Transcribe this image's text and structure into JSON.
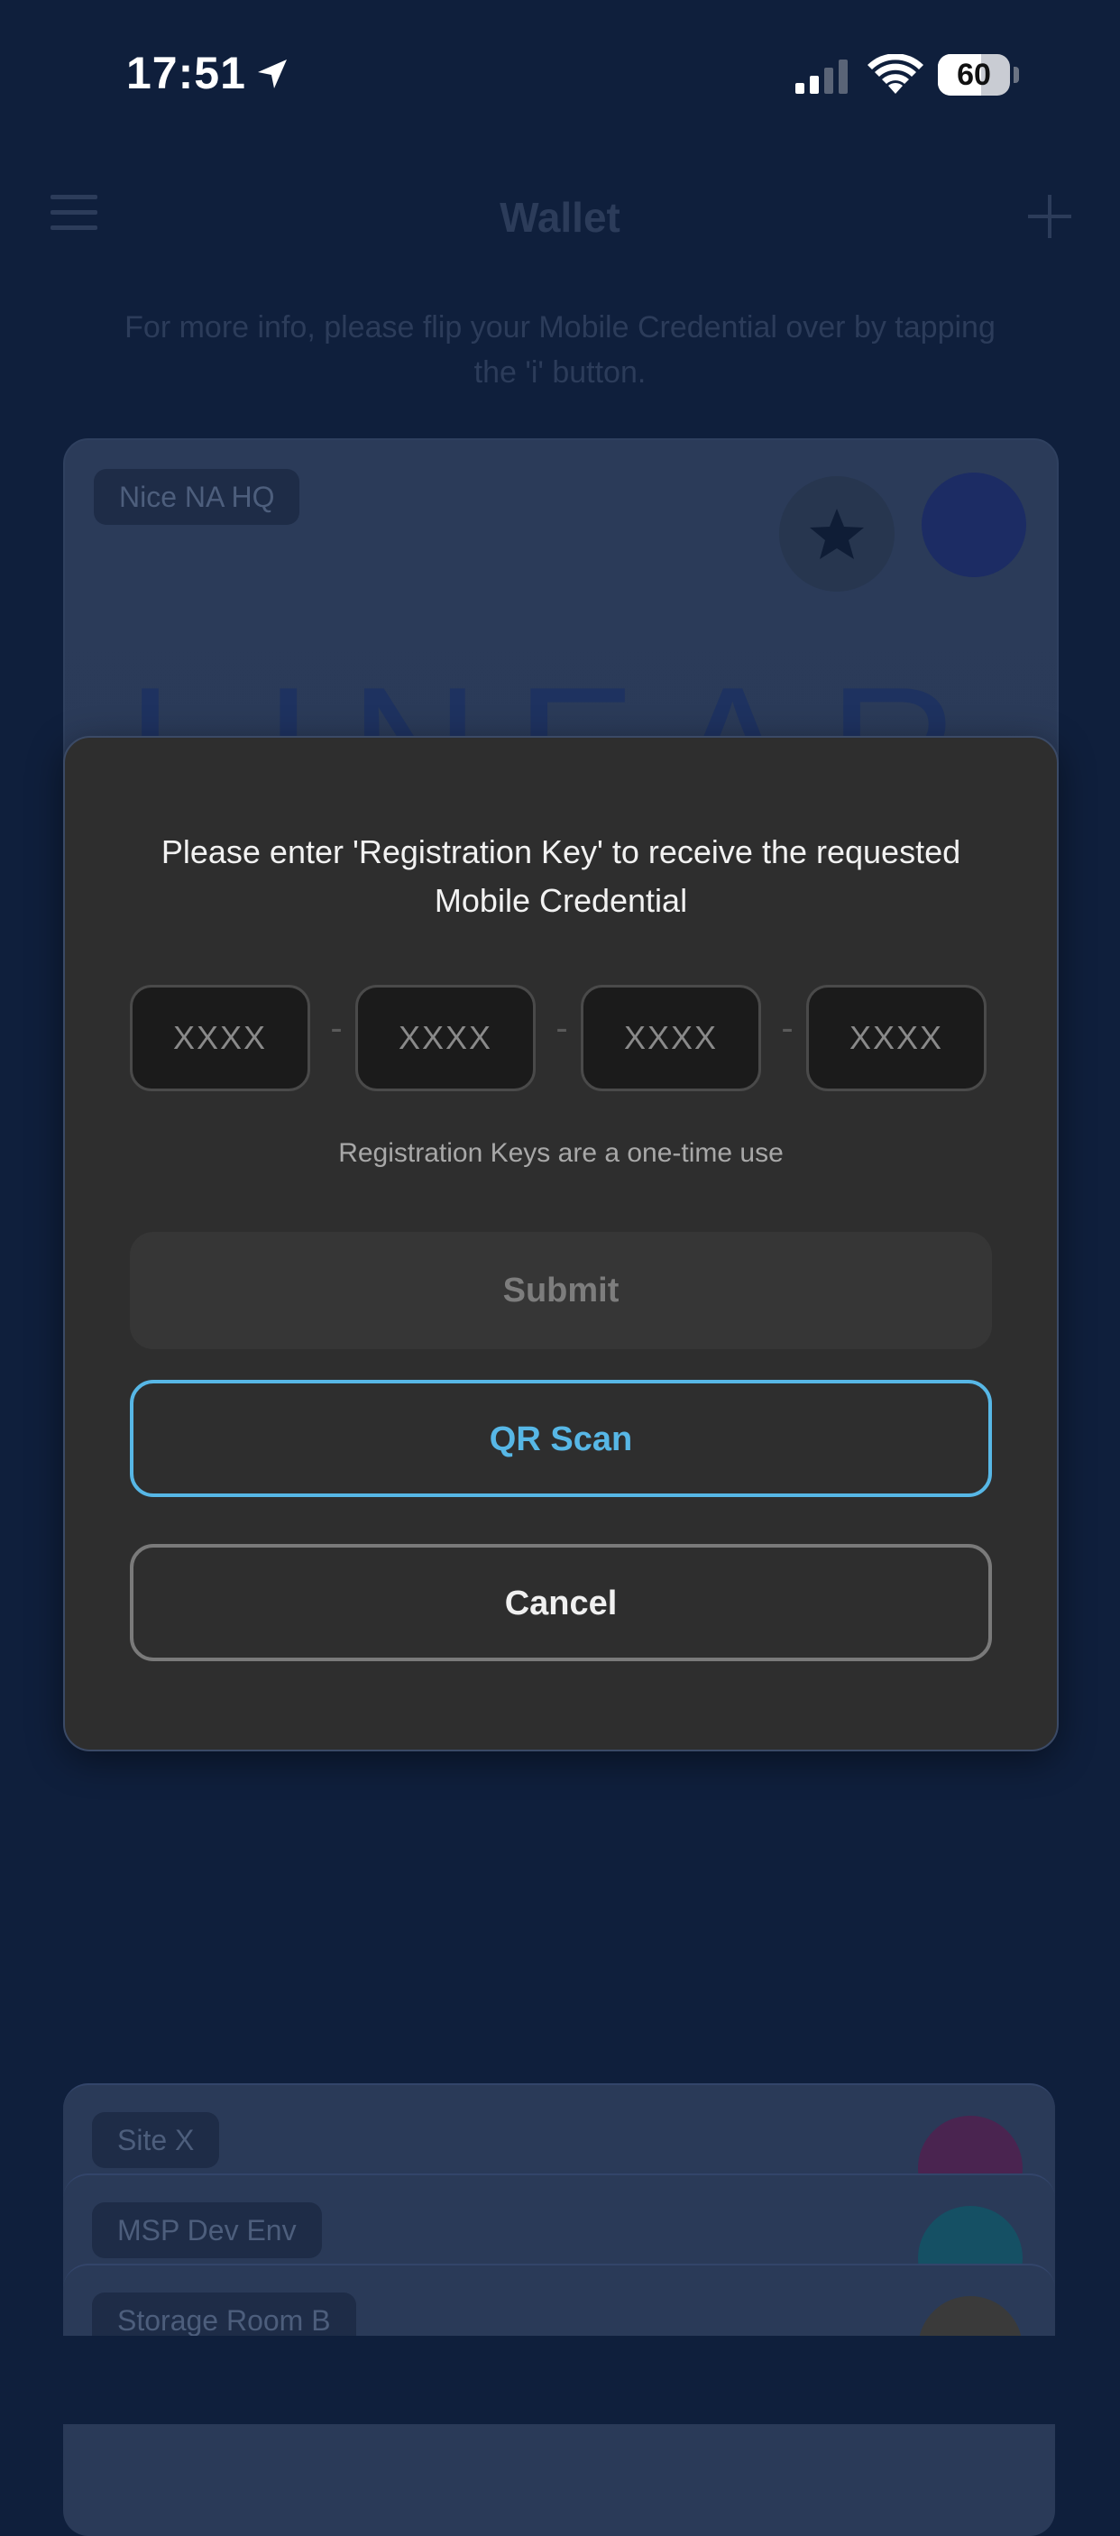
{
  "status_bar": {
    "time": "17:51",
    "battery_percent": "60",
    "battery_level": 0.6
  },
  "header": {
    "title": "Wallet",
    "info_text": "For more info, please flip your Mobile Credential over by tapping the 'i' button."
  },
  "credential_card": {
    "site_label": "Nice NA HQ",
    "logo_text": "LINEAR",
    "avatar_color": "#1c2c64"
  },
  "stacked_cards": [
    {
      "label": "Site X",
      "avatar_color": "#4a2450"
    },
    {
      "label": "MSP Dev Env",
      "avatar_color": "#155064"
    },
    {
      "label": "Storage Room B",
      "avatar_color": "#3a3a3a"
    }
  ],
  "dialog": {
    "message": "Please enter 'Registration Key' to receive the requested Mobile Credential",
    "key_placeholder": "XXXX",
    "separator": "-",
    "note": "Registration Keys are a one-time use",
    "submit_label": "Submit",
    "qr_label": "QR Scan",
    "cancel_label": "Cancel"
  },
  "colors": {
    "background": "#0f1f3c",
    "dialog": "#2e2e2e",
    "accent": "#57b7e6"
  }
}
